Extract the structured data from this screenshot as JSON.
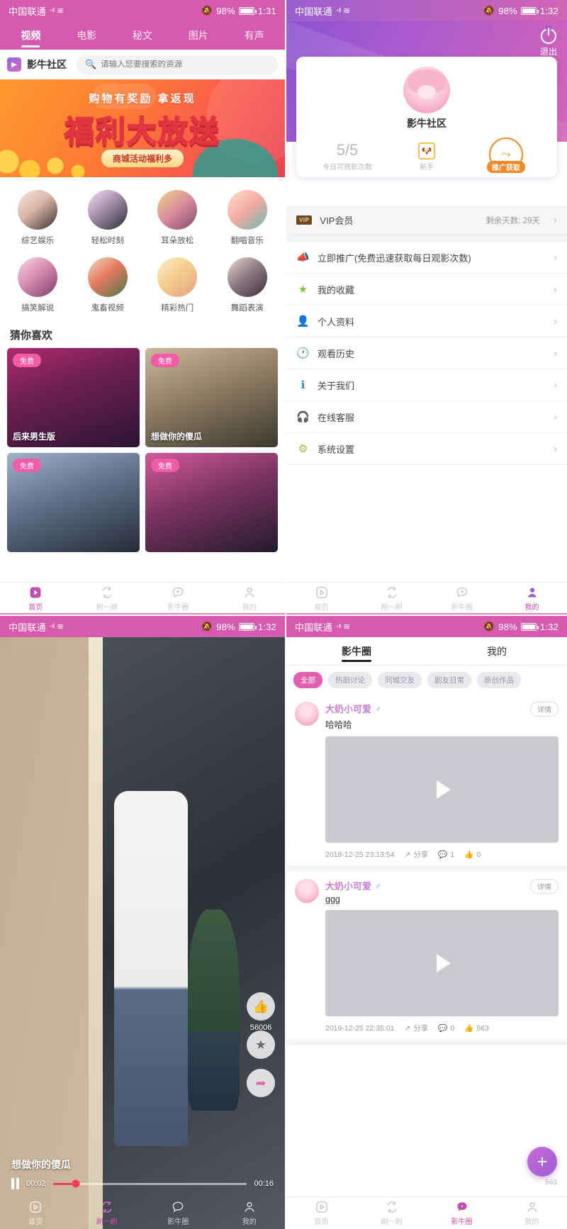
{
  "status_bar": {
    "carrier": "中国联通",
    "signal_icon": "signal-bars-icon",
    "wifi_icon": "wifi-icon",
    "mute_icon": "mute-icon",
    "battery": "98%",
    "time_1": "1:31",
    "time_2": "1:32"
  },
  "home": {
    "tabs": [
      {
        "label": "视频",
        "active": true
      },
      {
        "label": "电影",
        "active": false
      },
      {
        "label": "秘文",
        "active": false
      },
      {
        "label": "图片",
        "active": false
      },
      {
        "label": "有声",
        "active": false
      }
    ],
    "brand": "影牛社区",
    "search_placeholder": "请输入您要搜索的资源",
    "search_value": "",
    "banner": {
      "top_text": "购物有奖励 拿返现",
      "main_text": "福利大放送",
      "button_text": "商城活动福利多"
    },
    "categories": [
      {
        "label": "综艺娱乐"
      },
      {
        "label": "轻松时刻"
      },
      {
        "label": "耳朵放松"
      },
      {
        "label": "翻唱音乐"
      },
      {
        "label": "搞笑解说"
      },
      {
        "label": "鬼畜视频"
      },
      {
        "label": "精彩热门"
      },
      {
        "label": "舞蹈表演"
      }
    ],
    "section_title": "猜你喜欢",
    "videos": [
      {
        "badge": "免费",
        "title": "后来男生版"
      },
      {
        "badge": "免费",
        "title": "想做你的傻瓜"
      },
      {
        "badge": "免费",
        "title": ""
      },
      {
        "badge": "免费",
        "title": ""
      }
    ]
  },
  "bottom_nav": {
    "items": [
      {
        "label": "首页",
        "icon": "play-square-icon"
      },
      {
        "label": "刷一刷",
        "icon": "refresh-icon"
      },
      {
        "label": "影牛圈",
        "icon": "chat-bubble-icon"
      },
      {
        "label": "我的",
        "icon": "person-icon"
      }
    ],
    "active_home": "首页",
    "active_profile": "我的",
    "active_feed": "影牛圈"
  },
  "profile": {
    "logout_label": "退出",
    "logout_icon": "power-icon",
    "avatar_icon": "user-avatar",
    "username": "影牛社区",
    "views_count": "5/5",
    "views_label": "今日可观影次数",
    "level_icon": "dog-badge-icon",
    "level_label": "新手",
    "promo_button": "推广获取",
    "promo_icon": "share-nodes-icon",
    "vip": {
      "badge": "VIP",
      "label": "VIP会员",
      "value": "剩余天数: 29天"
    },
    "menu": [
      {
        "label": "立即推广(免费迅速获取每日观影次数)",
        "icon": "megaphone-icon",
        "color": "#f07a3a"
      },
      {
        "label": "我的收藏",
        "icon": "star-icon",
        "color": "#7ec143"
      },
      {
        "label": "个人资料",
        "icon": "person-icon",
        "color": "#e8453c"
      },
      {
        "label": "观看历史",
        "icon": "clock-icon",
        "color": "#f0962a"
      },
      {
        "label": "关于我们",
        "icon": "info-icon",
        "color": "#2a7ee0"
      },
      {
        "label": "在线客服",
        "icon": "headset-icon",
        "color": "#f0b52a"
      },
      {
        "label": "系统设置",
        "icon": "gear-icon",
        "color": "#8fc440"
      }
    ]
  },
  "player": {
    "title": "想做你的傻瓜",
    "current_time": "00:02",
    "total_time": "00:16",
    "progress_percent": 12,
    "pause_icon": "pause-icon",
    "actions": [
      {
        "icon": "thumbs-up-icon",
        "count": "56006"
      },
      {
        "icon": "star-icon",
        "count": ""
      },
      {
        "icon": "share-icon",
        "count": ""
      }
    ]
  },
  "feed": {
    "tabs": [
      {
        "label": "影牛圈",
        "active": true
      },
      {
        "label": "我的",
        "active": false
      }
    ],
    "chips": [
      {
        "label": "全部",
        "active": true
      },
      {
        "label": "热剧讨论",
        "active": false
      },
      {
        "label": "同城交友",
        "active": false
      },
      {
        "label": "剧友日常",
        "active": false
      },
      {
        "label": "原创作品",
        "active": false
      }
    ],
    "detail_label": "详情",
    "share_label": "分享",
    "posts": [
      {
        "author": "大奶小可爱",
        "gender_icon": "male-icon",
        "text": "哈哈哈",
        "timestamp": "2019-12-25 23:13:54",
        "comments": "1",
        "likes": "0"
      },
      {
        "author": "大奶小可爱",
        "gender_icon": "male-icon",
        "text": "ggg",
        "timestamp": "2019-12-25 22:35:01",
        "comments": "0",
        "likes": "563"
      }
    ],
    "fab_icon": "plus-icon"
  },
  "colors": {
    "pink": "#d65bb0",
    "purple": "#9b5fd0",
    "accent": "#e35fb0",
    "orange": "#f08a2a",
    "progress": "#ef3d5c"
  }
}
